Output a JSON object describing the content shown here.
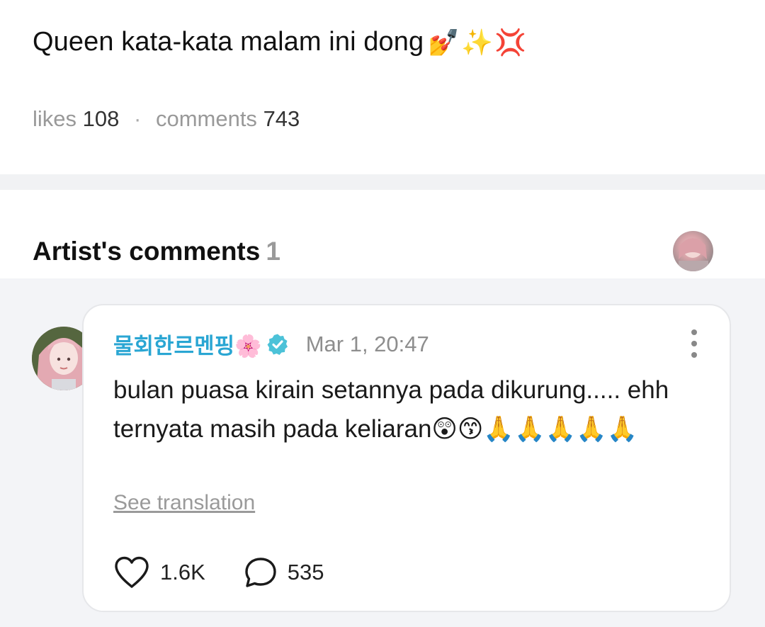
{
  "post": {
    "text": "Queen kata-kata malam ini dong",
    "emojis": [
      "💅",
      "✨",
      "💢"
    ],
    "likes_label": "likes",
    "likes_count": "108",
    "comments_label": "comments",
    "comments_count": "743",
    "separator": "·"
  },
  "artist_comments": {
    "title": "Artist's comments",
    "count": "1"
  },
  "comment": {
    "author": "물회한르멘핑🌸",
    "verified_icon": "verified-check-icon",
    "timestamp": "Mar 1, 20:47",
    "body": "bulan puasa kirain setannya pada dikurung..... ehh ternyata masih pada keliaran😲😙🙏🙏🙏🙏🙏",
    "see_translation": "See translation",
    "likes": "1.6K",
    "replies": "535"
  },
  "colors": {
    "author": "#2aa6d3",
    "verified": "#4cc2d8",
    "background_gray": "#f3f4f7",
    "muted_text": "#999999"
  }
}
